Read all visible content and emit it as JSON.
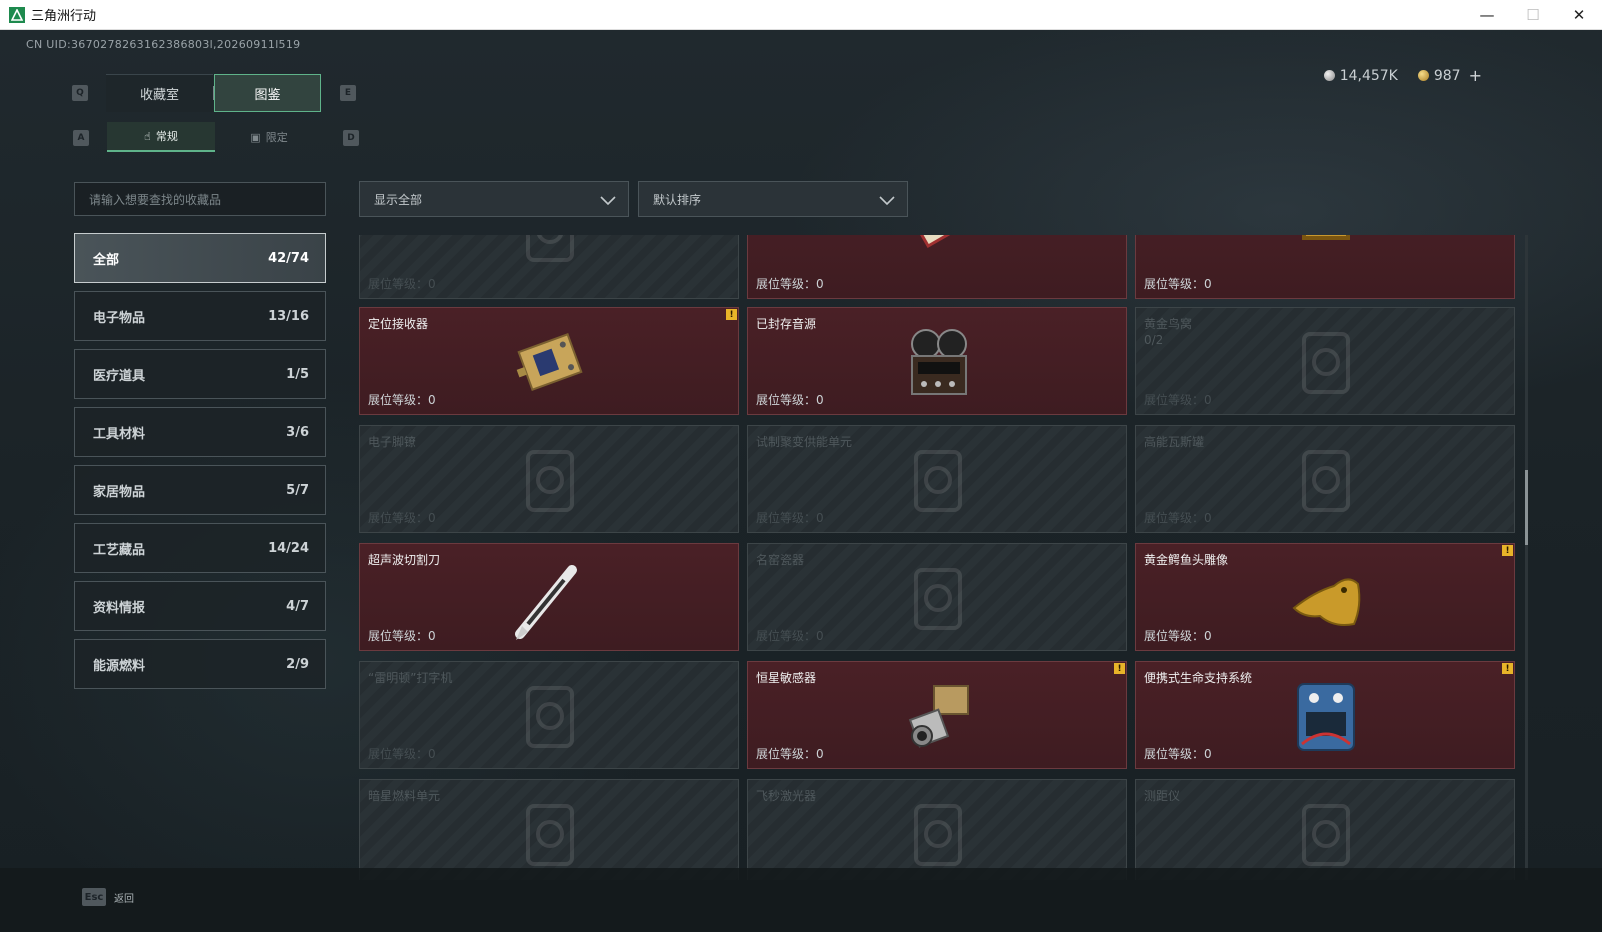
{
  "window": {
    "title": "三角洲行动",
    "minimize": "—",
    "maximize": "☐",
    "close": "✕"
  },
  "uid": "CN UID:3670278263162386803l,20260911l519",
  "currency": {
    "silver": "14,457K",
    "gold": "987",
    "add": "+"
  },
  "keys": {
    "prev_main": "Q",
    "next_main": "E",
    "prev_sub": "A",
    "next_sub": "D",
    "esc": "Esc"
  },
  "main_tabs": [
    {
      "label": "收藏室",
      "active": false
    },
    {
      "label": "图鉴",
      "active": true
    }
  ],
  "sub_tabs": [
    {
      "label": "常规",
      "active": true
    },
    {
      "label": "限定",
      "active": false
    }
  ],
  "search": {
    "placeholder": "请输入想要查找的收藏品"
  },
  "filters": {
    "show": "显示全部",
    "sort": "默认排序"
  },
  "categories": [
    {
      "label": "全部",
      "count": "42/74",
      "active": true
    },
    {
      "label": "电子物品",
      "count": "13/16"
    },
    {
      "label": "医疗道具",
      "count": "1/5"
    },
    {
      "label": "工具材料",
      "count": "3/6"
    },
    {
      "label": "家居物品",
      "count": "5/7"
    },
    {
      "label": "工艺藏品",
      "count": "14/24"
    },
    {
      "label": "资料情报",
      "count": "4/7"
    },
    {
      "label": "能源燃料",
      "count": "2/9"
    }
  ],
  "level_label": "展位等级：",
  "level_value": "0",
  "items": [
    {
      "name": "",
      "owned": false,
      "badge": false
    },
    {
      "name": "",
      "owned": true,
      "badge": false
    },
    {
      "name": "",
      "owned": true,
      "badge": false
    },
    {
      "name": "定位接收器",
      "owned": true,
      "badge": true
    },
    {
      "name": "已封存音源",
      "owned": true,
      "badge": false
    },
    {
      "name": "黄金鸟窝",
      "owned": false,
      "badge": false,
      "sub": "0/2"
    },
    {
      "name": "电子脚镣",
      "owned": false,
      "badge": false
    },
    {
      "name": "试制聚变供能单元",
      "owned": false,
      "badge": false
    },
    {
      "name": "高能瓦斯罐",
      "owned": false,
      "badge": false
    },
    {
      "name": "超声波切割刀",
      "owned": true,
      "badge": false
    },
    {
      "name": "名窑瓷器",
      "owned": false,
      "badge": false
    },
    {
      "name": "黄金鳄鱼头雕像",
      "owned": true,
      "badge": true
    },
    {
      "name": "“雷明顿”打字机",
      "owned": false,
      "badge": false
    },
    {
      "name": "恒星敏感器",
      "owned": true,
      "badge": true
    },
    {
      "name": "便携式生命支持系统",
      "owned": true,
      "badge": true
    },
    {
      "name": "暗星燃料单元",
      "owned": false,
      "badge": false
    },
    {
      "name": "飞秒激光器",
      "owned": false,
      "badge": false
    },
    {
      "name": "测距仪",
      "owned": false,
      "badge": false
    }
  ],
  "badge_glyph": "!",
  "back_label": "返回",
  "colors": {
    "accent": "#5fb38a",
    "owned_card": "#4a2026",
    "badge": "#e8b429"
  }
}
